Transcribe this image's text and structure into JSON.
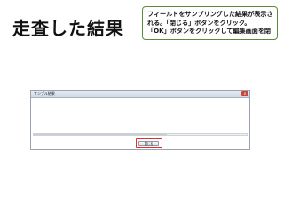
{
  "slide": {
    "title": "走査した結果"
  },
  "callout": {
    "lines": [
      "フィールドをサンプリングした結果が表示さ",
      "れる。「閉じる」ボタンをクリック。",
      "「OK」ボタンをクリックして編集画面を閉じる。"
    ]
  },
  "dialog": {
    "title": "サンプル結果",
    "close_label": "閉じる"
  },
  "colors": {
    "callout_border": "#5a8a3c",
    "highlight": "#e0302a"
  }
}
